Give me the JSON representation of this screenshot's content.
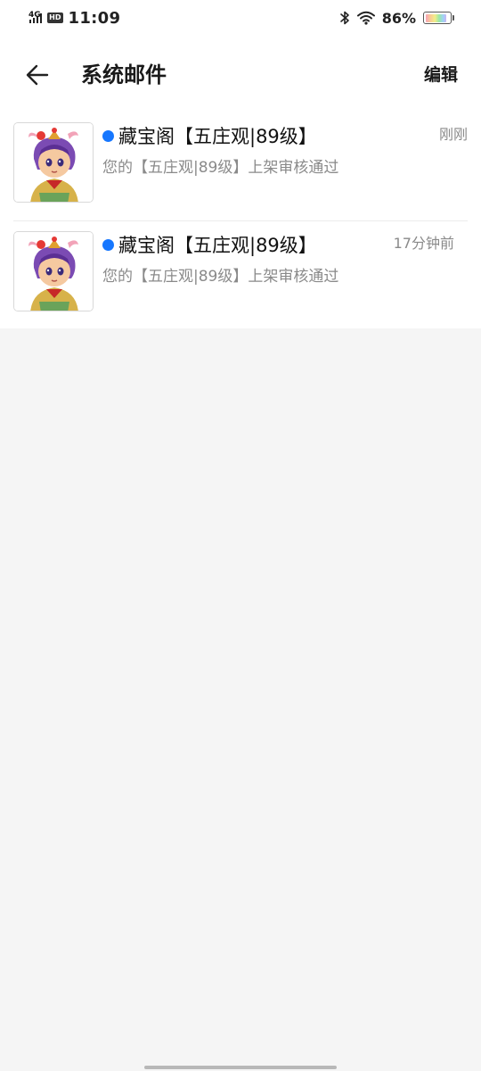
{
  "status_bar": {
    "network": "4G",
    "hd_badge": "HD",
    "time": "11:09",
    "battery_percent": "86%",
    "battery_level": 0.86
  },
  "header": {
    "back_icon": "arrow-left-icon",
    "title": "系统邮件",
    "edit_label": "编辑"
  },
  "mails": [
    {
      "title": "藏宝阁【五庄观|89级】",
      "time": "刚刚",
      "preview": "您的【五庄观|89级】上架审核通过",
      "unread": true,
      "avatar_icon": "character-avatar-icon"
    },
    {
      "title": "藏宝阁【五庄观|89级】",
      "time": "17分钟前",
      "preview": "您的【五庄观|89级】上架审核通过",
      "unread": true,
      "avatar_icon": "character-avatar-icon"
    }
  ],
  "colors": {
    "unread_dot": "#1677ff",
    "background": "#f5f5f5",
    "secondary_text": "#8a8a8a"
  }
}
